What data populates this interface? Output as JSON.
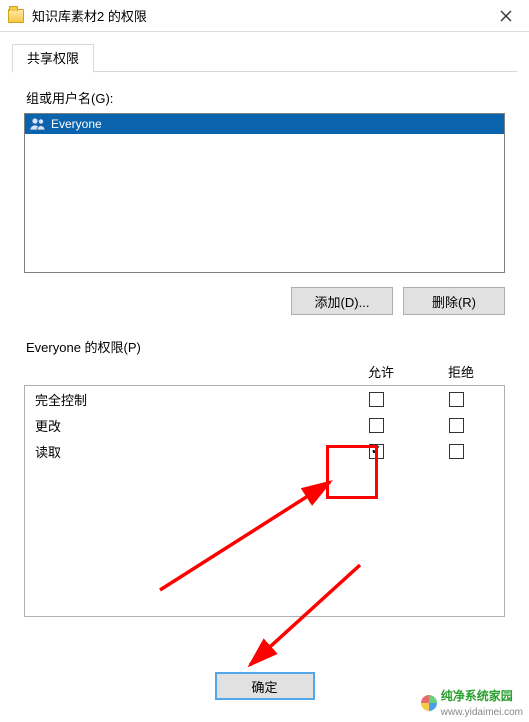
{
  "titlebar": {
    "title": "知识库素材2 的权限"
  },
  "tabs": {
    "share": "共享权限"
  },
  "group_label": "组或用户名(G):",
  "principals": [
    {
      "name": "Everyone"
    }
  ],
  "buttons": {
    "add": "添加(D)...",
    "remove": "删除(R)",
    "ok": "确定"
  },
  "perm_for_label": "Everyone 的权限(P)",
  "perm_cols": {
    "allow": "允许",
    "deny": "拒绝"
  },
  "perms": [
    {
      "name": "完全控制",
      "allow": false,
      "deny": false
    },
    {
      "name": "更改",
      "allow": false,
      "deny": false
    },
    {
      "name": "读取",
      "allow": true,
      "deny": false
    }
  ],
  "watermark": {
    "brand": "纯净系统家园",
    "url": "www.yidaimei.com"
  }
}
